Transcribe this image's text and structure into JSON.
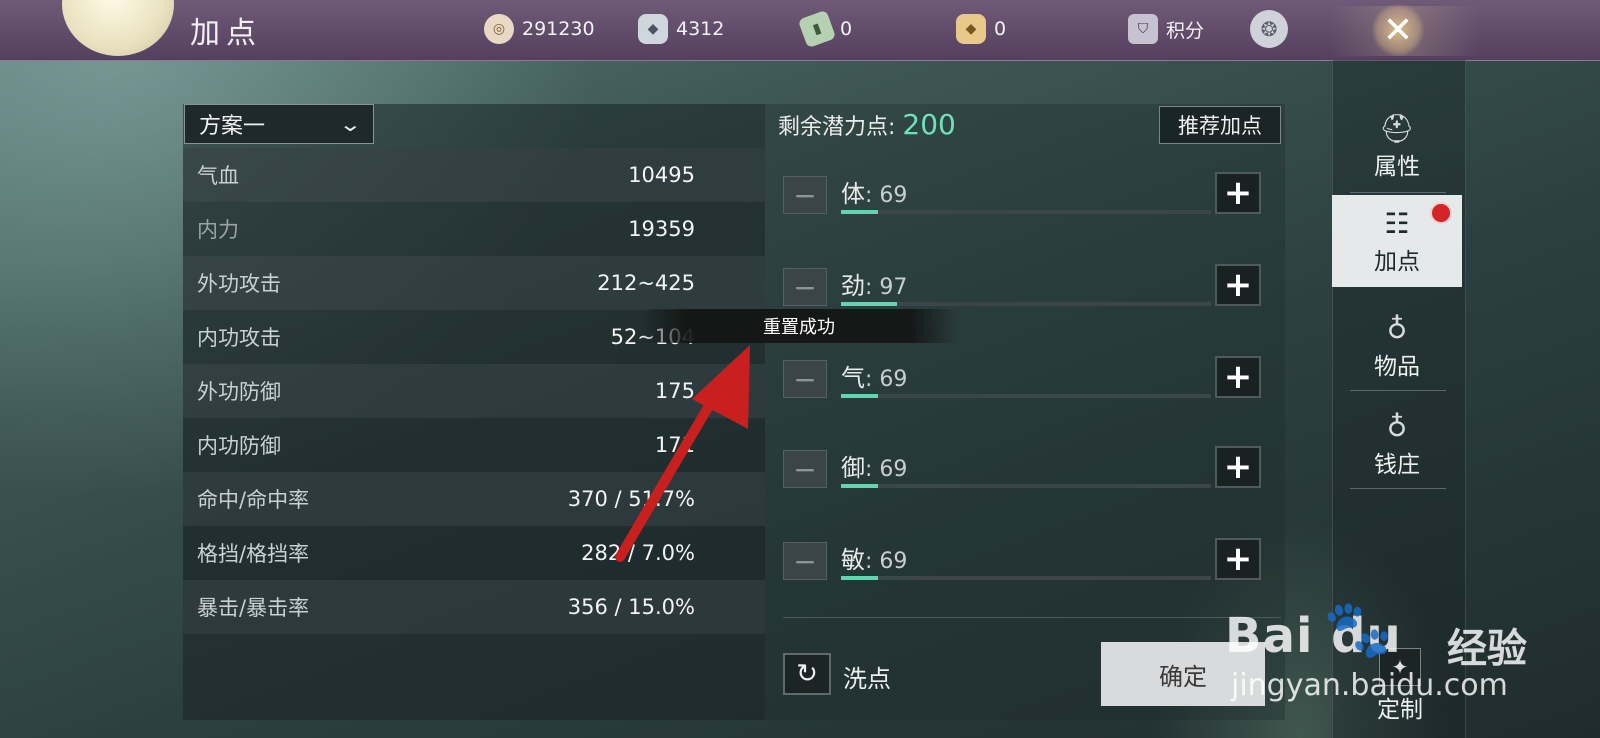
{
  "topbar": {
    "title": "加点",
    "resources": [
      {
        "icon": "coin-icon",
        "value": "291230"
      },
      {
        "icon": "silver-icon",
        "value": "4312"
      },
      {
        "icon": "ticket-icon",
        "value": "0"
      },
      {
        "icon": "gold-ingot-icon",
        "value": "0"
      },
      {
        "icon": "shield-icon",
        "value": "积分"
      }
    ],
    "close_glyph": "✕"
  },
  "scheme": {
    "selected": "方案一"
  },
  "stats": [
    {
      "name": "气血",
      "value": "10495"
    },
    {
      "name": "内力",
      "value": "19359"
    },
    {
      "name": "外功攻击",
      "value": "212~425"
    },
    {
      "name": "内功攻击",
      "value": "52~104"
    },
    {
      "name": "外功防御",
      "value": "175"
    },
    {
      "name": "内功防御",
      "value": "171"
    },
    {
      "name": "命中/命中率",
      "value": "370 / 51.7%"
    },
    {
      "name": "格挡/格挡率",
      "value": "282 / 7.0%"
    },
    {
      "name": "暴击/暴击率",
      "value": "356 / 15.0%"
    }
  ],
  "potential": {
    "label": "剩余潜力点:",
    "value": "200"
  },
  "recommend_label": "推荐加点",
  "attributes": [
    {
      "name": "体",
      "value": "69",
      "fill": 0.1
    },
    {
      "name": "劲",
      "value": "97",
      "fill": 0.15
    },
    {
      "name": "气",
      "value": "69",
      "fill": 0.1
    },
    {
      "name": "御",
      "value": "69",
      "fill": 0.1
    },
    {
      "name": "敏",
      "value": "69",
      "fill": 0.1
    }
  ],
  "attr_sep": ": ",
  "reset_label": "洗点",
  "confirm_label": "确定",
  "toast": "重置成功",
  "side_nav": [
    {
      "label": "属性",
      "icon": "hat-icon"
    },
    {
      "label": "加点",
      "icon": "sliders-icon",
      "active": true
    },
    {
      "label": "物品",
      "icon": "bag-icon"
    },
    {
      "label": "钱庄",
      "icon": "money-bag-icon"
    }
  ],
  "custom_label": "定制",
  "watermark": {
    "brand": "Bai du",
    "cn": "经验",
    "url": "jingyan.baidu.com"
  },
  "colors": {
    "accent": "#5fd6b0",
    "alert": "#d4242a",
    "arrow": "#c8201e"
  }
}
